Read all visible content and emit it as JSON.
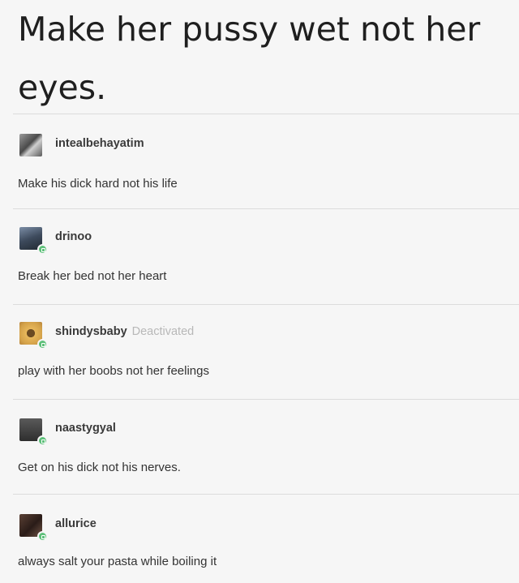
{
  "headline": "Make her pussy wet not her eyes.",
  "posts": [
    {
      "username": "intealbehayatim",
      "deactivated": "",
      "text": "Make his dick hard not his life",
      "avatar_color": "#6b6b6b",
      "has_badge": false
    },
    {
      "username": "drinoo",
      "deactivated": "",
      "text": "Break her bed not her heart",
      "avatar_color": "#3d4a5c",
      "has_badge": true
    },
    {
      "username": "shindysbaby",
      "deactivated": "Deactivated",
      "text": "play with her boobs not her feelings",
      "avatar_color": "#d4a24a",
      "has_badge": true
    },
    {
      "username": "naastygyal",
      "deactivated": "",
      "text": "Get on his dick not his nerves.",
      "avatar_color": "#4a4a4a",
      "has_badge": true
    },
    {
      "username": "allurice",
      "deactivated": "",
      "text": "always salt your pasta while boiling it",
      "avatar_color": "#3a2a24",
      "has_badge": true
    }
  ],
  "colors": {
    "background": "#f6f6f6",
    "badge": "#5ec07a",
    "deactivated": "#b8b8b8",
    "divider": "#dcdcdc"
  }
}
